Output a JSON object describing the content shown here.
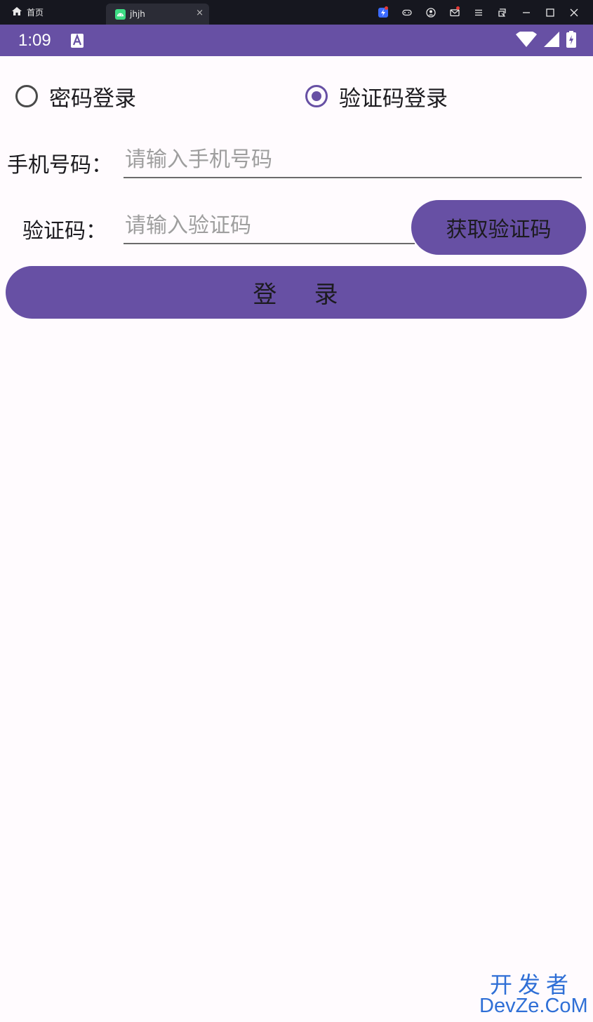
{
  "window": {
    "home_tab_label": "首页",
    "app_tab_label": "jhjh",
    "close_glyph": "×"
  },
  "statusbar": {
    "time": "1:09"
  },
  "login_mode": {
    "options": [
      {
        "label": "密码登录",
        "checked": false
      },
      {
        "label": "验证码登录",
        "checked": true
      }
    ]
  },
  "form": {
    "phone_label": "手机号码：",
    "phone_placeholder": "请输入手机号码",
    "code_label": "验证码：",
    "code_placeholder": "请输入验证码",
    "get_code_label": "获取验证码",
    "login_label": "登    录"
  },
  "watermark": {
    "line1": "开发者",
    "line2": "DevZe.CoM"
  },
  "colors": {
    "primary": "#6750a4",
    "titlebar": "#16171f",
    "background": "#fffbfe",
    "watermark": "#2f6fd6"
  }
}
